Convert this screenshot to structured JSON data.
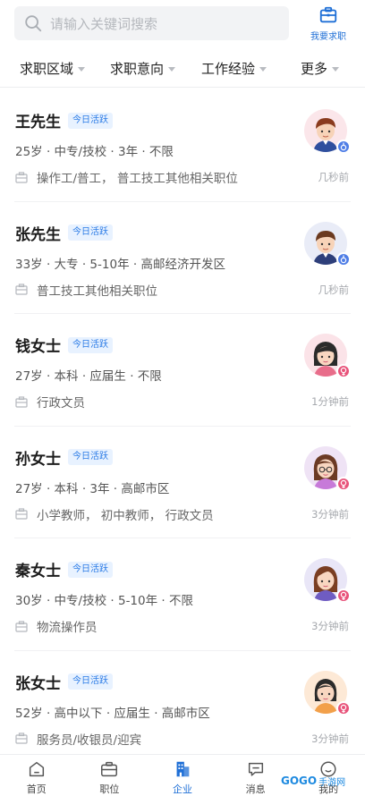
{
  "search": {
    "placeholder": "请输入关键词搜索"
  },
  "header": {
    "job_seek_label": "我要求职"
  },
  "filters": [
    {
      "label": "求职区域"
    },
    {
      "label": "求职意向"
    },
    {
      "label": "工作经验"
    },
    {
      "label": "更多"
    }
  ],
  "candidates": [
    {
      "name": "王先生",
      "badge": "今日活跃",
      "meta": "25岁 · 中专/技校 · 3年 · 不限",
      "job": "操作工/普工， 普工技工其他相关职位",
      "time": "几秒前",
      "gender": "male"
    },
    {
      "name": "张先生",
      "badge": "今日活跃",
      "meta": "33岁 · 大专 · 5-10年 · 高邮经济开发区",
      "job": "普工技工其他相关职位",
      "time": "几秒前",
      "gender": "male"
    },
    {
      "name": "钱女士",
      "badge": "今日活跃",
      "meta": "27岁 · 本科 · 应届生 · 不限",
      "job": "行政文员",
      "time": "1分钟前",
      "gender": "female"
    },
    {
      "name": "孙女士",
      "badge": "今日活跃",
      "meta": "27岁 · 本科 · 3年 · 高邮市区",
      "job": "小学教师， 初中教师， 行政文员",
      "time": "3分钟前",
      "gender": "female"
    },
    {
      "name": "秦女士",
      "badge": "今日活跃",
      "meta": "30岁 · 中专/技校 · 5-10年 · 不限",
      "job": "物流操作员",
      "time": "3分钟前",
      "gender": "female"
    },
    {
      "name": "张女士",
      "badge": "今日活跃",
      "meta": "52岁 · 高中以下 · 应届生 · 高邮市区",
      "job": "服务员/收银员/迎宾",
      "time": "3分钟前",
      "gender": "female"
    }
  ],
  "bottom_nav": [
    {
      "label": "首页",
      "icon": "home-icon"
    },
    {
      "label": "职位",
      "icon": "briefcase-icon"
    },
    {
      "label": "企业",
      "icon": "building-icon",
      "active": true
    },
    {
      "label": "消息",
      "icon": "message-icon"
    },
    {
      "label": "我的",
      "icon": "profile-icon"
    }
  ],
  "watermark": {
    "logo": "GOGO",
    "text": "手游网"
  },
  "colors": {
    "accent": "#1f6fd6",
    "badge_bg": "#e8f2ff",
    "male": "#4f7ee6",
    "female": "#e8537a"
  }
}
